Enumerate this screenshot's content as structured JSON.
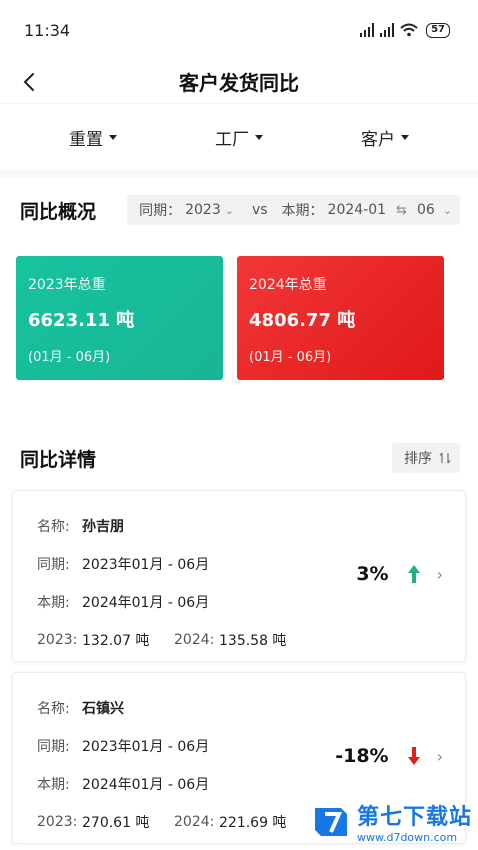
{
  "status_bar": {
    "time": "11:34",
    "battery": "57"
  },
  "nav": {
    "title": "客户发货同比"
  },
  "filters": [
    {
      "label": "重置"
    },
    {
      "label": "工厂"
    },
    {
      "label": "客户"
    }
  ],
  "overview": {
    "title": "同比概况",
    "period": {
      "compare_label": "同期：",
      "compare_value": "2023",
      "vs": "vs",
      "current_label": "本期：",
      "current_start": "2024-01",
      "current_end": "06"
    },
    "totals": [
      {
        "label": "2023年总重",
        "value": "6623.11 吨",
        "range": "(01月 - 06月)",
        "color": "#18b593"
      },
      {
        "label": "2024年总重",
        "value": "4806.77 吨",
        "range": "(01月 - 06月)",
        "color": "#e82020"
      }
    ]
  },
  "details": {
    "title": "同比详情",
    "sort_label": "排序",
    "field_labels": {
      "name": "名称:",
      "compare": "同期:",
      "current": "本期:",
      "year_a": "2023:",
      "year_b": "2024:"
    },
    "items": [
      {
        "name": "孙吉朋",
        "compare": "2023年01月 - 06月",
        "current": "2024年01月 - 06月",
        "value_a": "132.07 吨",
        "value_b": "135.58 吨",
        "percent": "3%",
        "trend": "up"
      },
      {
        "name": "石镇兴",
        "compare": "2023年01月 - 06月",
        "current": "2024年01月 - 06月",
        "value_a": "270.61 吨",
        "value_b": "221.69 吨",
        "percent": "-18%",
        "trend": "down"
      }
    ]
  },
  "colors": {
    "up": "#1fb37a",
    "down": "#e02020",
    "accent_green": "#18b593",
    "accent_red": "#e82020"
  },
  "watermark": {
    "name": "第七下载站",
    "url": "www.d7down.com"
  }
}
